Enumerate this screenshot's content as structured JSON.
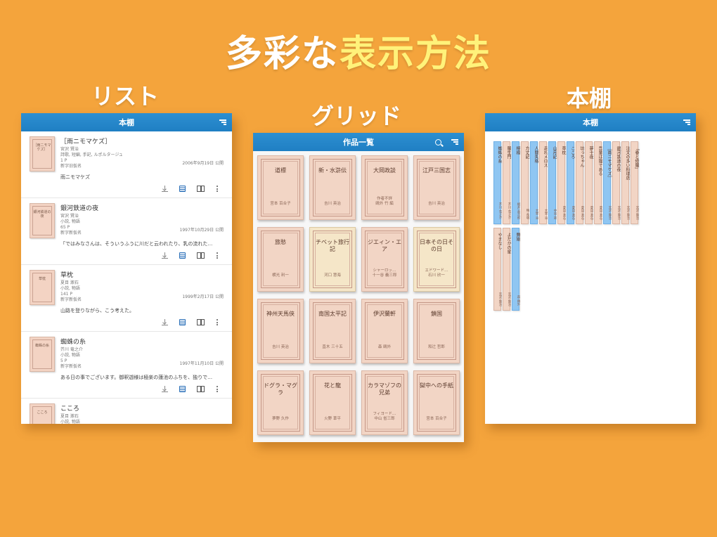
{
  "headline": {
    "part1": "多彩な",
    "part2": "表示方法"
  },
  "sections": {
    "list": "リスト",
    "grid": "グリッド",
    "shelf": "本棚"
  },
  "list_panel": {
    "title": "本棚",
    "items": [
      {
        "title": "［雨ニモマケズ］",
        "author": "宮沢 賢治",
        "genre": "詩歌, 短編, 手記, ルポルタージュ",
        "pages": "1 P",
        "kana": "新字旧仮名",
        "date": "2006年9月19日 公開",
        "excerpt": "雨ニモマケズ",
        "cover": "［雨ニモマケズ］"
      },
      {
        "title": "銀河鉄道の夜",
        "author": "宮沢 賢治",
        "genre": "小説, 物語",
        "pages": "65 P",
        "kana": "新字新仮名",
        "date": "1997年10月29日 公開",
        "excerpt": "「ではみなさんは、そういうふうに川だと云われたり、乳の流れた…",
        "cover": "銀河鉄道の夜"
      },
      {
        "title": "草枕",
        "author": "夏目 漱石",
        "genre": "小説, 物語",
        "pages": "141 P",
        "kana": "新字新仮名",
        "date": "1999年2月17日 公開",
        "excerpt": "山路を登りながら、こう考えた。",
        "cover": "草枕"
      },
      {
        "title": "蜘蛛の糸",
        "author": "芥川 竜之介",
        "genre": "小説, 物語",
        "pages": "5 P",
        "kana": "新字新仮名",
        "date": "1997年11月10日 公開",
        "excerpt": "ある日の事でございます。御釈迦様は極楽の蓮池のふちを、独りで…",
        "cover": "蜘蛛の糸"
      },
      {
        "title": "こころ",
        "author": "夏目 漱石",
        "genre": "小説, 物語",
        "pages": "",
        "kana": "",
        "date": "",
        "excerpt": "",
        "cover": "こころ"
      }
    ]
  },
  "grid_panel": {
    "title": "作品一覧",
    "covers": [
      {
        "title": "道標",
        "author": "宮本 百合子",
        "pale": false
      },
      {
        "title": "新・水滸伝",
        "author": "吉川 英治",
        "pale": false
      },
      {
        "title": "大岡政談",
        "author": "作者不詳\n鴎外 竹 編",
        "pale": false
      },
      {
        "title": "江戸三国志",
        "author": "吉川 英治",
        "pale": false
      },
      {
        "title": "旅愁",
        "author": "横光 利一",
        "pale": false
      },
      {
        "title": "チベット旅行記",
        "author": "河口 慧海",
        "pale": true
      },
      {
        "title": "ジエィン・エア",
        "author": "シャーロッ…\n十一谷 義三郎",
        "pale": false
      },
      {
        "title": "日本その日その日",
        "author": "エドワード…\n石川 欣一",
        "pale": true
      },
      {
        "title": "神州天馬侠",
        "author": "吉川 英治",
        "pale": false
      },
      {
        "title": "南国太平記",
        "author": "直木 三十五",
        "pale": false
      },
      {
        "title": "伊沢蘭軒",
        "author": "森 鴎外",
        "pale": false
      },
      {
        "title": "鎖国",
        "author": "和辻 哲郎",
        "pale": false
      },
      {
        "title": "ドグラ・マグラ",
        "author": "夢野 久作",
        "pale": false
      },
      {
        "title": "花と龍",
        "author": "火野 葦平",
        "pale": false
      },
      {
        "title": "カラマゾフの兄弟",
        "author": "フィヨード…\n中山 省三郎",
        "pale": false
      },
      {
        "title": "獄中への手紙",
        "author": "宮本 百合子",
        "pale": false
      }
    ]
  },
  "shelf_panel": {
    "title": "本棚",
    "row1": [
      {
        "title": "蜘蛛の糸",
        "author": "芥川 竜之介",
        "blue": true
      },
      {
        "title": "羅生門",
        "author": "芥川 竜之介",
        "blue": false
      },
      {
        "title": "檸檬",
        "author": "梶井 基次郎",
        "blue": true
      },
      {
        "title": "方丈記",
        "author": "鴨 長明",
        "blue": false
      },
      {
        "title": "人間失格",
        "author": "太宰 治",
        "blue": true
      },
      {
        "title": "走れメロス",
        "author": "太宰 治",
        "blue": false
      },
      {
        "title": "山月記",
        "author": "中島 敦",
        "blue": true
      },
      {
        "title": "草枕",
        "author": "夏目 漱石",
        "blue": false
      },
      {
        "title": "こころ",
        "author": "夏目 漱石",
        "blue": true
      },
      {
        "title": "坊っちゃん",
        "author": "夏目 漱石",
        "blue": false
      },
      {
        "title": "夢十夜",
        "author": "夏目 漱石",
        "blue": false
      },
      {
        "title": "吾輩は猫である",
        "author": "夏目 漱石",
        "blue": false
      },
      {
        "title": "［雨ニモマケズ］",
        "author": "宮沢 賢治",
        "blue": true
      },
      {
        "title": "銀河鉄道の夜",
        "author": "宮沢 賢治",
        "blue": false
      },
      {
        "title": "注文の多い料理店",
        "author": "宮沢 賢治",
        "blue": false
      },
      {
        "title": "「春と修羅」",
        "author": "宮沢 賢治",
        "blue": false
      }
    ],
    "row2": [
      {
        "title": "やまなし",
        "author": "宮沢 賢治",
        "blue": false
      },
      {
        "title": "よだかの星",
        "author": "宮沢 賢治",
        "blue": false
      },
      {
        "title": "舞姫",
        "author": "森 鴎外",
        "blue": true
      }
    ]
  }
}
